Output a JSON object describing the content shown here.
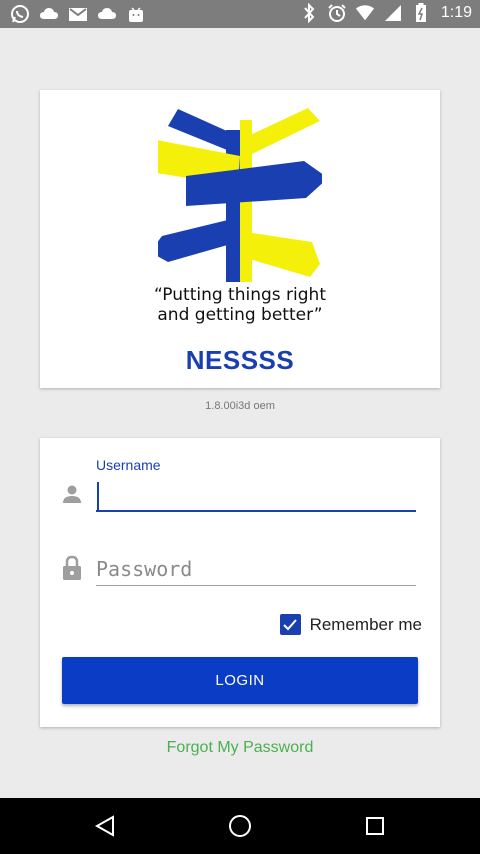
{
  "status_bar": {
    "time": "1:19",
    "left_icons": [
      "whatsapp-icon",
      "cloud-icon",
      "gmail-icon",
      "cloud-icon",
      "bag-icon"
    ],
    "right_icons": [
      "bluetooth-icon",
      "alarm-icon",
      "wifi-icon",
      "signal-icon",
      "battery-icon"
    ]
  },
  "logo": {
    "tagline_line1": "“Putting things right",
    "tagline_line2": "and getting better”",
    "brand": "NESSSS",
    "colors": {
      "blue": "#1a3fb0",
      "yellow": "#f5f00a"
    }
  },
  "version": "1.8.00i3d oem",
  "login_form": {
    "username_label": "Username",
    "username_value": "",
    "password_placeholder": "Password",
    "remember_label": "Remember me",
    "remember_checked": true,
    "login_button": "LOGIN"
  },
  "forgot_link": "Forgot My Password",
  "nav_bar": {
    "icons": [
      "back-icon",
      "home-icon",
      "recents-icon"
    ]
  },
  "colors": {
    "accent": "#0a3cc6",
    "link": "#4caf50",
    "status_bar": "#7d7d7d"
  }
}
